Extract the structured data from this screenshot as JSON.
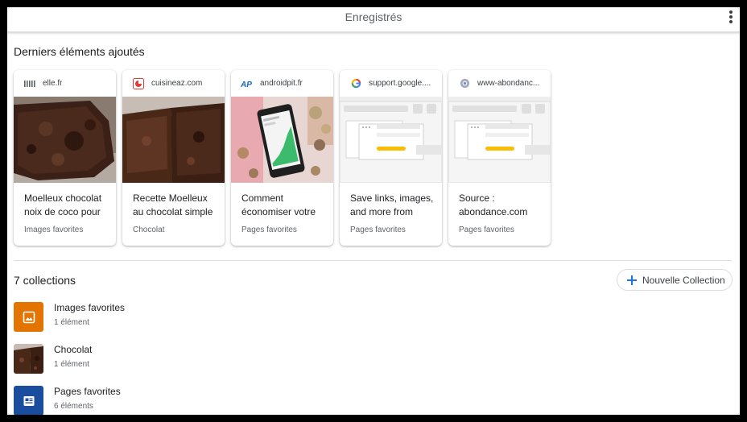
{
  "header": {
    "title": "Enregistrés"
  },
  "recent": {
    "title": "Derniers éléments ajoutés",
    "cards": [
      {
        "domain": "elle.fr",
        "favicon": "elle-logo-icon",
        "title": "Moelleux chocolat noix de coco pour",
        "collection": "Images favorites",
        "thumb": "chocolate-cake-photo"
      },
      {
        "domain": "cuisineaz.com",
        "favicon": "cuisineaz-logo-icon",
        "title": "Recette Moelleux au chocolat simple",
        "collection": "Chocolat",
        "thumb": "chocolate-cake-slices-photo"
      },
      {
        "domain": "androidpit.fr",
        "favicon": "androidpit-logo-icon",
        "title": "Comment économiser votre",
        "collection": "Pages favorites",
        "thumb": "phone-with-money-photo"
      },
      {
        "domain": "support.google....",
        "favicon": "google-logo-icon",
        "title": "Save links, images, and more from",
        "collection": "Pages favorites",
        "thumb": "browser-illustration"
      },
      {
        "domain": "www-abondanc...",
        "favicon": "globe-icon",
        "title": "Source : abondance.com",
        "collection": "Pages favorites",
        "thumb": "browser-illustration"
      }
    ]
  },
  "collections": {
    "count_label": "7 collections",
    "new_button": "Nouvelle Collection",
    "items": [
      {
        "name": "Images favorites",
        "count": "1 élément",
        "icon": "image-icon",
        "color": "#e37400"
      },
      {
        "name": "Chocolat",
        "count": "1 élément",
        "icon": "chocolate-cake-photo"
      },
      {
        "name": "Pages favorites",
        "count": "6 éléments",
        "icon": "page-icon",
        "color": "#1a4d9e"
      }
    ]
  },
  "colors": {
    "accent": "#1a73e8",
    "google_yellow": "#fbbc04"
  }
}
